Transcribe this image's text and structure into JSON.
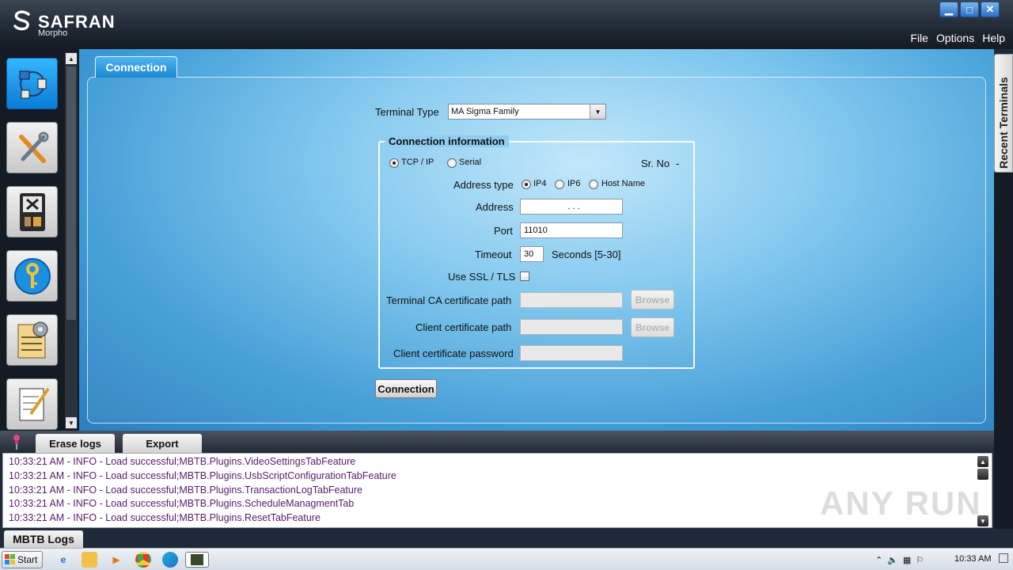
{
  "app": {
    "brand": "SAFRAN",
    "brand_sub": "Morpho",
    "menu": [
      "File",
      "Options",
      "Help"
    ]
  },
  "tab": {
    "label": "Connection"
  },
  "recent_terminals": "Recent Terminals",
  "form": {
    "terminal_type_label": "Terminal Type",
    "terminal_type_value": "MA Sigma Family",
    "group_title": "Connection information",
    "conn_tcp": "TCP / IP",
    "conn_serial": "Serial",
    "srno_label": "Sr. No",
    "srno_value": "-",
    "address_type_label": "Address type",
    "addr_ip4": "IP4",
    "addr_ip6": "IP6",
    "addr_host": "Host Name",
    "address_label": "Address",
    "address_value": ".       .       .",
    "port_label": "Port",
    "port_value": "11010",
    "timeout_label": "Timeout",
    "timeout_value": "30",
    "timeout_unit": "Seconds [5-30]",
    "ssl_label": "Use SSL / TLS",
    "ca_label": "Terminal CA certificate path",
    "client_cert_label": "Client certificate path",
    "client_pwd_label": "Client certificate password",
    "browse": "Browse",
    "connect_button": "Connection"
  },
  "logs": {
    "erase": "Erase logs",
    "export": "Export",
    "lines": [
      "10:33:21 AM - INFO - Load successful;MBTB.Plugins.VideoSettingsTabFeature",
      "10:33:21 AM - INFO - Load successful;MBTB.Plugins.UsbScriptConfigurationTabFeature",
      "10:33:21 AM - INFO - Load successful;MBTB.Plugins.TransactionLogTabFeature",
      "10:33:21 AM - INFO - Load successful;MBTB.Plugins.ScheduleManagmentTab",
      "10:33:21 AM - INFO - Load successful;MBTB.Plugins.ResetTabFeature"
    ],
    "tab": "MBTB Logs",
    "watermark": "ANY RUN"
  },
  "taskbar": {
    "start": "Start",
    "clock": "10:33 AM"
  },
  "icons": {
    "left_toolbar": [
      "connection-icon",
      "tools-icon",
      "terminal-icon",
      "key-icon",
      "settings-list-icon",
      "notepad-icon"
    ]
  },
  "colors": {
    "accent": "#1b88d2",
    "log_text": "#5a1a6e"
  }
}
